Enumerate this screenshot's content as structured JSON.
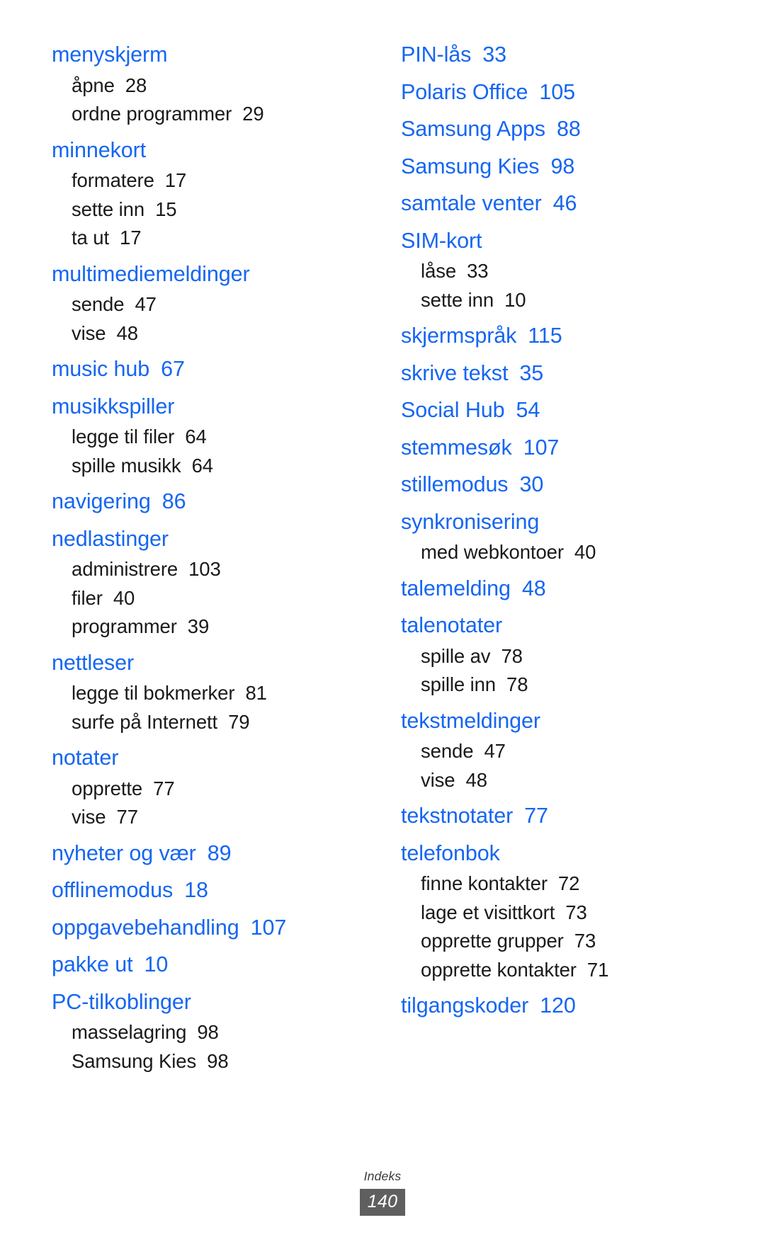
{
  "footer": {
    "label": "Indeks",
    "page_number": "140"
  },
  "colors": {
    "entry_blue": "#1566f2",
    "subentry_black": "#1a1a1a",
    "badge_background": "#5f5f5f",
    "badge_text": "#ffffff"
  },
  "columns": {
    "left": [
      {
        "type": "entry",
        "term": "menyskjerm",
        "page": ""
      },
      {
        "type": "subentry",
        "term": "åpne",
        "page": "28"
      },
      {
        "type": "subentry",
        "term": "ordne programmer",
        "page": "29"
      },
      {
        "type": "entry",
        "term": "minnekort",
        "page": ""
      },
      {
        "type": "subentry",
        "term": "formatere",
        "page": "17"
      },
      {
        "type": "subentry",
        "term": "sette inn",
        "page": "15"
      },
      {
        "type": "subentry",
        "term": "ta ut",
        "page": "17"
      },
      {
        "type": "entry",
        "term": "multimediemeldinger",
        "page": ""
      },
      {
        "type": "subentry",
        "term": "sende",
        "page": "47"
      },
      {
        "type": "subentry",
        "term": "vise",
        "page": "48"
      },
      {
        "type": "entry",
        "term": "music hub",
        "page": "67"
      },
      {
        "type": "entry",
        "term": "musikkspiller",
        "page": ""
      },
      {
        "type": "subentry",
        "term": "legge til filer",
        "page": "64"
      },
      {
        "type": "subentry",
        "term": "spille musikk",
        "page": "64"
      },
      {
        "type": "entry",
        "term": "navigering",
        "page": "86"
      },
      {
        "type": "entry",
        "term": "nedlastinger",
        "page": ""
      },
      {
        "type": "subentry",
        "term": "administrere",
        "page": "103"
      },
      {
        "type": "subentry",
        "term": "filer",
        "page": "40"
      },
      {
        "type": "subentry",
        "term": "programmer",
        "page": "39"
      },
      {
        "type": "entry",
        "term": "nettleser",
        "page": ""
      },
      {
        "type": "subentry",
        "term": "legge til bokmerker",
        "page": "81"
      },
      {
        "type": "subentry",
        "term": "surfe på Internett",
        "page": "79"
      },
      {
        "type": "entry",
        "term": "notater",
        "page": ""
      },
      {
        "type": "subentry",
        "term": "opprette",
        "page": "77"
      },
      {
        "type": "subentry",
        "term": "vise",
        "page": "77"
      },
      {
        "type": "entry",
        "term": "nyheter og vær",
        "page": "89"
      },
      {
        "type": "entry",
        "term": "offlinemodus",
        "page": "18"
      },
      {
        "type": "entry",
        "term": "oppgavebehandling",
        "page": "107"
      },
      {
        "type": "entry",
        "term": "pakke ut",
        "page": "10"
      },
      {
        "type": "entry",
        "term": "PC-tilkoblinger",
        "page": ""
      },
      {
        "type": "subentry",
        "term": "masselagring",
        "page": "98"
      },
      {
        "type": "subentry",
        "term": "Samsung Kies",
        "page": "98"
      }
    ],
    "right": [
      {
        "type": "entry",
        "term": "PIN-lås",
        "page": "33"
      },
      {
        "type": "entry",
        "term": "Polaris Office",
        "page": "105"
      },
      {
        "type": "entry",
        "term": "Samsung Apps",
        "page": "88"
      },
      {
        "type": "entry",
        "term": "Samsung Kies",
        "page": "98"
      },
      {
        "type": "entry",
        "term": "samtale venter",
        "page": "46"
      },
      {
        "type": "entry",
        "term": "SIM-kort",
        "page": ""
      },
      {
        "type": "subentry",
        "term": "låse",
        "page": "33"
      },
      {
        "type": "subentry",
        "term": "sette inn",
        "page": "10"
      },
      {
        "type": "entry",
        "term": "skjermspråk",
        "page": "115"
      },
      {
        "type": "entry",
        "term": "skrive tekst",
        "page": "35"
      },
      {
        "type": "entry",
        "term": "Social Hub",
        "page": "54"
      },
      {
        "type": "entry",
        "term": "stemmesøk",
        "page": "107"
      },
      {
        "type": "entry",
        "term": "stillemodus",
        "page": "30"
      },
      {
        "type": "entry",
        "term": "synkronisering",
        "page": ""
      },
      {
        "type": "subentry",
        "term": "med webkontoer",
        "page": "40"
      },
      {
        "type": "entry",
        "term": "talemelding",
        "page": "48"
      },
      {
        "type": "entry",
        "term": "talenotater",
        "page": ""
      },
      {
        "type": "subentry",
        "term": "spille av",
        "page": "78"
      },
      {
        "type": "subentry",
        "term": "spille inn",
        "page": "78"
      },
      {
        "type": "entry",
        "term": "tekstmeldinger",
        "page": ""
      },
      {
        "type": "subentry",
        "term": "sende",
        "page": "47"
      },
      {
        "type": "subentry",
        "term": "vise",
        "page": "48"
      },
      {
        "type": "entry",
        "term": "tekstnotater",
        "page": "77"
      },
      {
        "type": "entry",
        "term": "telefonbok",
        "page": ""
      },
      {
        "type": "subentry",
        "term": "finne kontakter",
        "page": "72"
      },
      {
        "type": "subentry",
        "term": "lage et visittkort",
        "page": "73"
      },
      {
        "type": "subentry",
        "term": "opprette grupper",
        "page": "73"
      },
      {
        "type": "subentry",
        "term": "opprette kontakter",
        "page": "71"
      },
      {
        "type": "entry",
        "term": "tilgangskoder",
        "page": "120"
      }
    ]
  }
}
